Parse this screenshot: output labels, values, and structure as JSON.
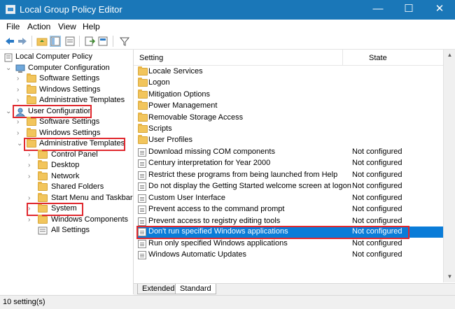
{
  "window": {
    "title": "Local Group Policy Editor",
    "minimize_glyph": "—",
    "maximize_glyph": "☐",
    "close_glyph": "✕"
  },
  "menu": {
    "items": [
      "File",
      "Action",
      "View",
      "Help"
    ]
  },
  "tree": {
    "root": "Local Computer Policy",
    "computer_config": "Computer Configuration",
    "cc_software": "Software Settings",
    "cc_windows": "Windows Settings",
    "cc_admin": "Administrative Templates",
    "user_config": "User Configuration",
    "uc_software": "Software Settings",
    "uc_windows": "Windows Settings",
    "uc_admin": "Administrative Templates",
    "control_panel": "Control Panel",
    "desktop": "Desktop",
    "network": "Network",
    "shared_folders": "Shared Folders",
    "start_menu": "Start Menu and Taskbar",
    "system": "System",
    "windows_components": "Windows Components",
    "all_settings": "All Settings"
  },
  "list": {
    "col_setting": "Setting",
    "col_state": "State",
    "rows": [
      {
        "name": "Locale Services",
        "state": ""
      },
      {
        "name": "Logon",
        "state": ""
      },
      {
        "name": "Mitigation Options",
        "state": ""
      },
      {
        "name": "Power Management",
        "state": ""
      },
      {
        "name": "Removable Storage Access",
        "state": ""
      },
      {
        "name": "Scripts",
        "state": ""
      },
      {
        "name": "User Profiles",
        "state": ""
      },
      {
        "name": "Download missing COM components",
        "state": "Not configured"
      },
      {
        "name": "Century interpretation for Year 2000",
        "state": "Not configured"
      },
      {
        "name": "Restrict these programs from being launched from Help",
        "state": "Not configured"
      },
      {
        "name": "Do not display the Getting Started welcome screen at logon",
        "state": "Not configured"
      },
      {
        "name": "Custom User Interface",
        "state": "Not configured"
      },
      {
        "name": "Prevent access to the command prompt",
        "state": "Not configured"
      },
      {
        "name": "Prevent access to registry editing tools",
        "state": "Not configured"
      },
      {
        "name": "Don't run specified Windows applications",
        "state": "Not configured"
      },
      {
        "name": "Run only specified Windows applications",
        "state": "Not configured"
      },
      {
        "name": "Windows Automatic Updates",
        "state": "Not configured"
      }
    ]
  },
  "tabs": [
    "Extended",
    "Standard"
  ],
  "status": {
    "text": "10 setting(s)"
  },
  "colors": {
    "titlebar": "#1a77b8",
    "selection": "#0a7cd8",
    "highlight_box": "#e0282e",
    "folder": "#f2c55c"
  }
}
